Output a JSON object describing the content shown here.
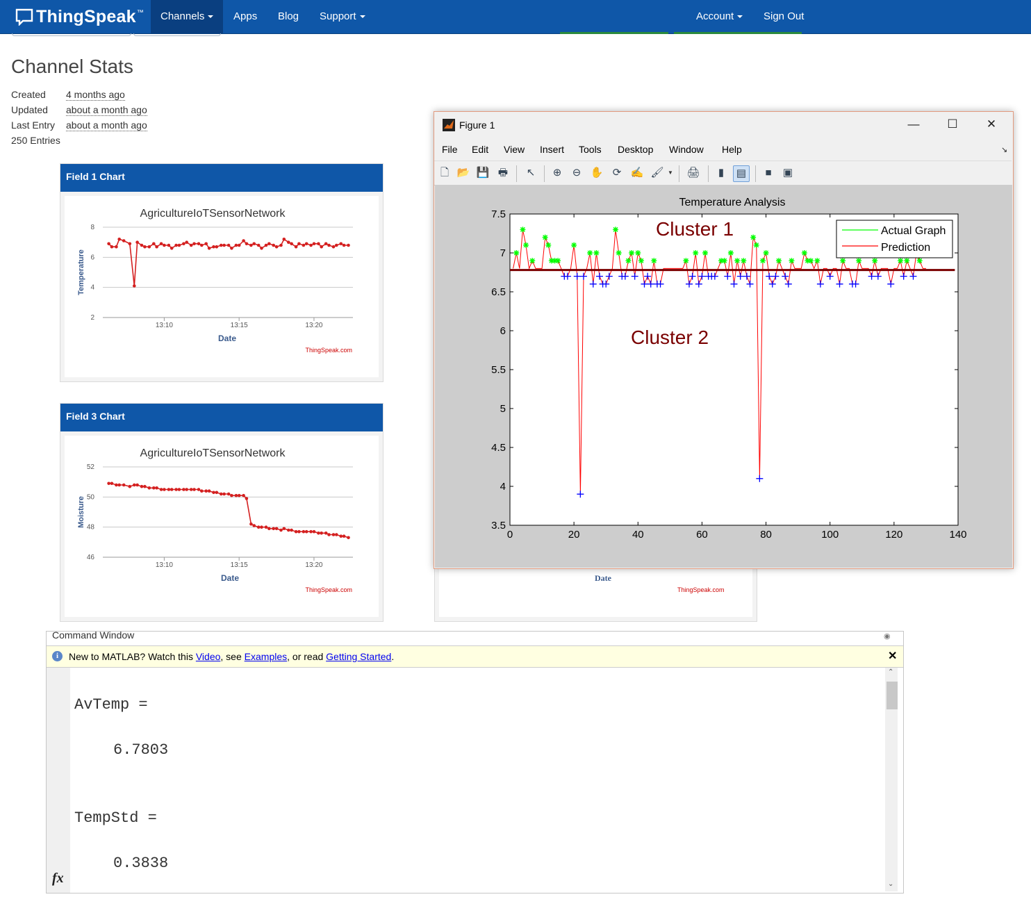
{
  "navbar": {
    "brand": "ThingSpeak",
    "tm": "™",
    "items": [
      "Channels",
      "Apps",
      "Blog",
      "Support"
    ],
    "right_items": [
      "Account",
      "Sign Out"
    ]
  },
  "stats": {
    "title": "Channel Stats",
    "rows": [
      {
        "label": "Created",
        "value": "4 months ago"
      },
      {
        "label": "Updated",
        "value": "about a month ago"
      },
      {
        "label": "Last Entry",
        "value": "about a month ago"
      }
    ],
    "entries": "250 Entries"
  },
  "field1": {
    "panel_title": "Field 1 Chart",
    "chart_title": "AgricultureIoTSensorNetwork",
    "ylabel": "Temperature",
    "xlabel": "Date",
    "credit": "ThingSpeak.com",
    "yticks": [
      "8",
      "6",
      "4",
      "2"
    ],
    "xticks": [
      "13:10",
      "13:15",
      "13:20"
    ]
  },
  "field3": {
    "panel_title": "Field 3 Chart",
    "chart_title": "AgricultureIoTSensorNetwork",
    "ylabel": "Moisture",
    "xlabel": "Date",
    "credit": "ThingSpeak.com",
    "yticks": [
      "52",
      "50",
      "48",
      "46"
    ],
    "xticks": [
      "13:10",
      "13:15",
      "13:20"
    ]
  },
  "hidden_panel": {
    "xlabel": "Date",
    "credit": "ThingSpeak.com"
  },
  "figure": {
    "window_title": "Figure 1",
    "menus": [
      "File",
      "Edit",
      "View",
      "Insert",
      "Tools",
      "Desktop",
      "Window",
      "Help"
    ],
    "title": "Temperature Analysis",
    "annotations": [
      "Cluster 1",
      "Cluster 2"
    ],
    "legend": [
      "Actual Graph",
      "Prediction"
    ],
    "colors": {
      "actual": "#00ff00",
      "prediction": "#ff0000",
      "mean": "#7a0000",
      "outlier": "#0000ff",
      "cluster": "#7a0000"
    }
  },
  "command_window": {
    "header": "Command Window",
    "info_prefix": "New to MATLAB? Watch this ",
    "link_video": "Video",
    "info_mid1": ", see ",
    "link_examples": "Examples",
    "info_mid2": ", or read ",
    "link_started": "Getting Started",
    "info_end": ".",
    "lines": [
      {
        "name": "AvTemp =",
        "value": "6.7803"
      },
      {
        "name": "TempStd =",
        "value": "0.3838"
      }
    ],
    "fx": "fx"
  },
  "chart_data": [
    {
      "type": "line",
      "title": "AgricultureIoTSensorNetwork",
      "xlabel": "Date",
      "ylabel": "Temperature",
      "ylim": [
        2,
        8
      ],
      "x_ticks": [
        "13:10",
        "13:15",
        "13:20"
      ],
      "x_minutes": [
        6.3,
        6.5,
        6.8,
        7.0,
        7.3,
        7.7,
        8.0,
        8.2,
        8.5,
        8.7,
        9.0,
        9.3,
        9.5,
        9.8,
        10.0,
        10.3,
        10.5,
        10.8,
        11.0,
        11.3,
        11.5,
        11.8,
        12.0,
        12.3,
        12.5,
        12.8,
        13.0,
        13.3,
        13.5,
        13.8,
        14.0,
        14.3,
        14.5,
        14.8,
        15.0,
        15.3,
        15.5,
        15.8,
        16.0,
        16.3,
        16.5,
        16.8,
        17.0,
        17.3,
        17.5,
        17.8,
        18.0,
        18.3,
        18.5,
        18.8,
        19.0,
        19.3,
        19.5,
        19.8,
        20.0,
        20.3,
        20.5,
        20.8,
        21.0,
        21.3,
        21.5,
        21.8,
        22.0,
        22.3
      ],
      "values": [
        6.9,
        6.7,
        6.7,
        7.2,
        7.1,
        6.9,
        4.1,
        7.0,
        6.8,
        6.7,
        6.7,
        6.9,
        6.7,
        6.9,
        6.8,
        6.8,
        6.6,
        6.8,
        6.8,
        6.9,
        7.0,
        6.8,
        6.9,
        6.9,
        6.8,
        6.9,
        6.6,
        6.7,
        6.7,
        6.8,
        6.8,
        6.8,
        6.6,
        6.8,
        6.8,
        7.1,
        6.9,
        6.8,
        6.9,
        6.8,
        6.6,
        6.8,
        6.9,
        6.8,
        6.7,
        6.8,
        7.2,
        7.0,
        6.9,
        6.7,
        6.9,
        6.8,
        6.9,
        6.8,
        6.9,
        6.9,
        6.7,
        6.9,
        6.8,
        6.7,
        6.8,
        6.9,
        6.8,
        6.8
      ]
    },
    {
      "type": "line",
      "title": "AgricultureIoTSensorNetwork",
      "xlabel": "Date",
      "ylabel": "Moisture",
      "ylim": [
        46,
        52
      ],
      "x_ticks": [
        "13:10",
        "13:15",
        "13:20"
      ],
      "x_minutes": [
        6.3,
        6.5,
        6.8,
        7.0,
        7.3,
        7.7,
        8.0,
        8.2,
        8.5,
        8.7,
        9.0,
        9.3,
        9.5,
        9.8,
        10.0,
        10.3,
        10.5,
        10.8,
        11.0,
        11.3,
        11.5,
        11.8,
        12.0,
        12.3,
        12.5,
        12.8,
        13.0,
        13.3,
        13.5,
        13.8,
        14.0,
        14.3,
        14.5,
        14.8,
        15.0,
        15.3,
        15.5,
        15.8,
        16.0,
        16.3,
        16.5,
        16.8,
        17.0,
        17.3,
        17.5,
        17.8,
        18.0,
        18.3,
        18.5,
        18.8,
        19.0,
        19.3,
        19.5,
        19.8,
        20.0,
        20.3,
        20.5,
        20.8,
        21.0,
        21.3,
        21.5,
        21.8,
        22.0,
        22.3
      ],
      "values": [
        50.9,
        50.9,
        50.8,
        50.8,
        50.8,
        50.7,
        50.8,
        50.8,
        50.7,
        50.7,
        50.6,
        50.6,
        50.6,
        50.5,
        50.5,
        50.5,
        50.5,
        50.5,
        50.5,
        50.5,
        50.5,
        50.5,
        50.5,
        50.5,
        50.4,
        50.4,
        50.4,
        50.3,
        50.3,
        50.2,
        50.2,
        50.2,
        50.1,
        50.1,
        50.1,
        50.1,
        49.9,
        48.2,
        48.1,
        48.0,
        48.0,
        48.0,
        47.9,
        47.9,
        47.9,
        47.8,
        47.9,
        47.8,
        47.8,
        47.7,
        47.7,
        47.7,
        47.7,
        47.7,
        47.7,
        47.6,
        47.6,
        47.6,
        47.5,
        47.5,
        47.5,
        47.4,
        47.4,
        47.3
      ]
    },
    {
      "type": "line",
      "title": "Temperature Analysis",
      "xlim": [
        0,
        140
      ],
      "ylim": [
        3.5,
        7.5
      ],
      "x_ticks": [
        0,
        20,
        40,
        60,
        80,
        100,
        120,
        140
      ],
      "y_ticks": [
        3.5,
        4,
        4.5,
        5,
        5.5,
        6,
        6.5,
        7,
        7.5
      ],
      "series": [
        {
          "name": "Actual Graph"
        },
        {
          "name": "Prediction",
          "x_start": 1,
          "values": [
            6.8,
            7.0,
            6.8,
            7.3,
            7.1,
            6.8,
            6.9,
            6.8,
            6.8,
            6.8,
            7.2,
            7.1,
            6.9,
            6.9,
            6.9,
            6.8,
            6.7,
            6.7,
            6.8,
            7.1,
            6.7,
            3.9,
            6.7,
            6.8,
            7.0,
            6.6,
            7.0,
            6.7,
            6.6,
            6.6,
            6.7,
            6.8,
            7.3,
            7.0,
            6.7,
            6.7,
            6.9,
            7.0,
            6.7,
            7.0,
            6.9,
            6.6,
            6.7,
            6.6,
            6.9,
            6.6,
            6.6,
            6.8,
            6.8,
            6.8,
            6.8,
            6.8,
            6.8,
            6.8,
            6.9,
            6.6,
            6.7,
            7.0,
            6.6,
            6.7,
            7.0,
            6.7,
            6.7,
            6.7,
            6.8,
            6.9,
            6.9,
            6.7,
            7.0,
            6.6,
            6.9,
            6.7,
            6.9,
            6.7,
            6.6,
            7.2,
            7.1,
            4.1,
            6.9,
            7.0,
            6.7,
            6.6,
            6.7,
            6.9,
            6.8,
            6.7,
            6.6,
            6.9,
            6.8,
            6.8,
            6.8,
            7.0,
            6.9,
            6.9,
            6.8,
            6.9,
            6.6,
            6.8,
            6.8,
            6.7,
            6.8,
            6.8,
            6.6,
            6.9,
            6.8,
            6.8,
            6.6,
            6.6,
            6.9,
            6.8,
            6.8,
            6.8,
            6.7,
            6.9,
            6.7,
            6.8,
            6.8,
            6.8,
            6.6,
            6.8,
            6.8,
            6.9,
            6.7,
            6.9,
            6.8,
            6.7,
            7.0,
            6.9,
            6.8,
            6.8
          ]
        },
        {
          "name": "Mean",
          "value": 6.78
        }
      ]
    }
  ]
}
